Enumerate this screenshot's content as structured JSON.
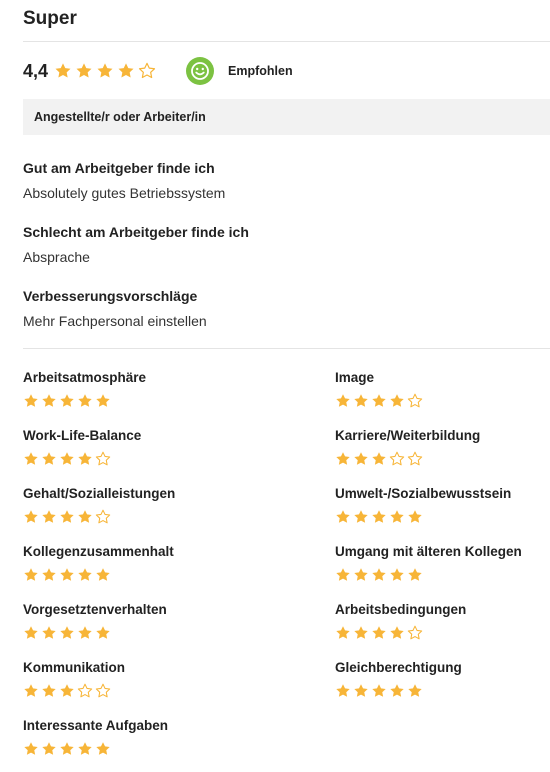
{
  "review": {
    "title": "Super",
    "score": "4,4",
    "score_value": 4.4,
    "recommendation": "Empfohlen",
    "role": "Angestellte/r oder Arbeiter/in",
    "sections": [
      {
        "heading": "Gut am Arbeitgeber finde ich",
        "text": "Absolutely gutes Betriebssystem"
      },
      {
        "heading": "Schlecht am Arbeitgeber finde ich",
        "text": "Absprache"
      },
      {
        "heading": "Verbesserungsvorschläge",
        "text": "Mehr Fachpersonal einstellen"
      }
    ],
    "categories": [
      {
        "name": "Arbeitsatmosphäre",
        "stars": 5
      },
      {
        "name": "Image",
        "stars": 4
      },
      {
        "name": "Work-Life-Balance",
        "stars": 4
      },
      {
        "name": "Karriere/Weiterbildung",
        "stars": 3
      },
      {
        "name": "Gehalt/Sozialleistungen",
        "stars": 4
      },
      {
        "name": "Umwelt-/Sozialbewusstsein",
        "stars": 5
      },
      {
        "name": "Kollegenzusammenhalt",
        "stars": 5
      },
      {
        "name": "Umgang mit älteren Kollegen",
        "stars": 5
      },
      {
        "name": "Vorgesetztenverhalten",
        "stars": 5
      },
      {
        "name": "Arbeitsbedingungen",
        "stars": 4
      },
      {
        "name": "Kommunikation",
        "stars": 3
      },
      {
        "name": "Gleichberechtigung",
        "stars": 5
      },
      {
        "name": "Interessante Aufgaben",
        "stars": 5
      }
    ]
  },
  "colors": {
    "star": "#f7b538",
    "recommend": "#7cc242",
    "divider": "#e4e4e4",
    "role_bg": "#f2f2f2"
  },
  "icons": {
    "star_full": "star-icon",
    "star_half": "star-half-icon",
    "star_empty": "star-outline-icon",
    "recommend": "smiley-icon"
  }
}
